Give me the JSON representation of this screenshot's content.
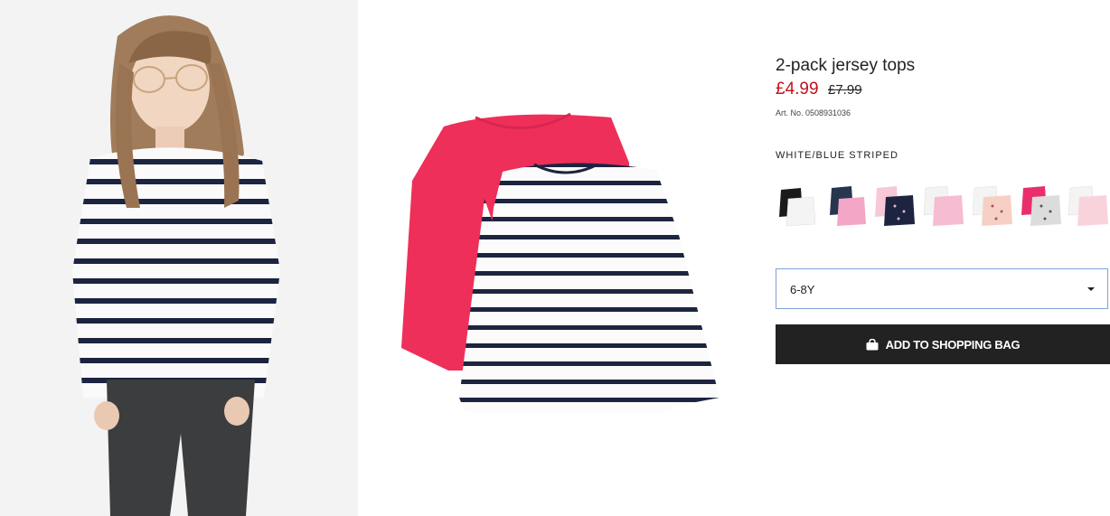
{
  "product": {
    "title": "2-pack jersey tops",
    "price_sale": "£4.99",
    "price_original": "£7.99",
    "article_number": "Art. No. 0508931036",
    "color_name": "WHITE/BLUE STRIPED",
    "swatches": [
      {
        "name": "black-white"
      },
      {
        "name": "navy-pink"
      },
      {
        "name": "pink-navy-print"
      },
      {
        "name": "white-pink"
      },
      {
        "name": "white-pink-print"
      },
      {
        "name": "pink-grey-print"
      },
      {
        "name": "white-light-pink"
      }
    ],
    "size_selected": "6-8Y",
    "add_to_bag_label": "ADD TO SHOPPING BAG"
  },
  "colors": {
    "sale_red": "#c4111b",
    "button_black": "#222222",
    "select_border": "#7fa3d6",
    "shirt_pink": "#ee2f59",
    "stripe_navy": "#1c2440"
  },
  "images": {
    "model": "girl-in-striped-top-photo",
    "product": "striped-and-pink-tops-photo"
  }
}
